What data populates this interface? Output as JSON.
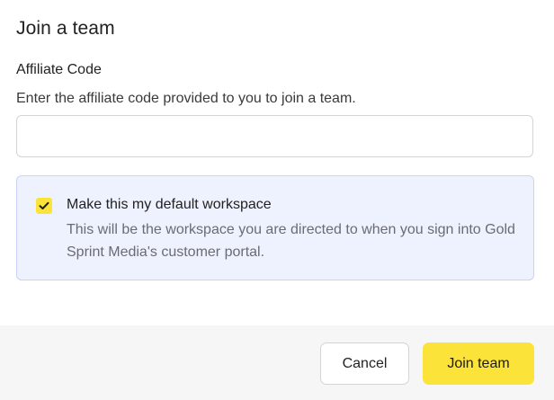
{
  "dialog": {
    "title": "Join a team"
  },
  "affiliate": {
    "label": "Affiliate Code",
    "help": "Enter the affiliate code provided to you to join a team.",
    "value": "",
    "placeholder": ""
  },
  "default_workspace": {
    "checked": true,
    "title": "Make this my default workspace",
    "description": "This will be the workspace you are directed to when you sign into Gold Sprint Media's customer portal.",
    "icon": "check-icon"
  },
  "footer": {
    "cancel_label": "Cancel",
    "join_label": "Join team"
  },
  "colors": {
    "accent": "#fbe33a",
    "info_bg": "#eef2fe",
    "info_border": "#c9d3f3"
  }
}
